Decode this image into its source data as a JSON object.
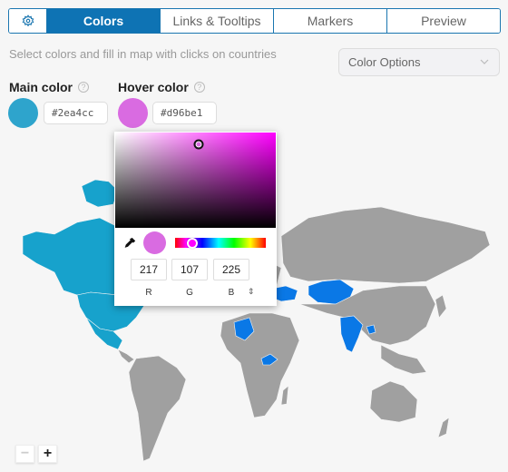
{
  "tabs": [
    {
      "id": "settings",
      "icon": "gear-icon",
      "label": ""
    },
    {
      "id": "colors",
      "label": "Colors",
      "active": true
    },
    {
      "id": "links",
      "label": "Links & Tooltips"
    },
    {
      "id": "markers",
      "label": "Markers"
    },
    {
      "id": "preview",
      "label": "Preview"
    }
  ],
  "hint": "Select colors and fill in map with clicks on countries",
  "color_options": {
    "label": "Color Options"
  },
  "main_color": {
    "label": "Main color",
    "value": "#2ea4cc",
    "help": "?"
  },
  "hover_color": {
    "label": "Hover color",
    "value": "#d96be1",
    "help": "?"
  },
  "picker": {
    "r": "217",
    "g": "107",
    "b": "225",
    "labels": {
      "r": "R",
      "g": "G",
      "b": "B"
    },
    "mode_toggle": "⇕",
    "hue_position_fraction": 0.19,
    "sv_saturation": 0.52,
    "sv_value": 0.88
  },
  "map": {
    "main_color_countries": [
      "Canada",
      "United States",
      "Mexico",
      "Greenland"
    ],
    "selected_countries": [
      "Algeria",
      "Ukraine",
      "Kazakhstan",
      "India",
      "Bangladesh",
      "Central African Republic"
    ],
    "selected_color": "#0a78e6",
    "land_color": "#a0a0a0"
  },
  "zoom": {
    "minus": "−",
    "plus": "+"
  }
}
